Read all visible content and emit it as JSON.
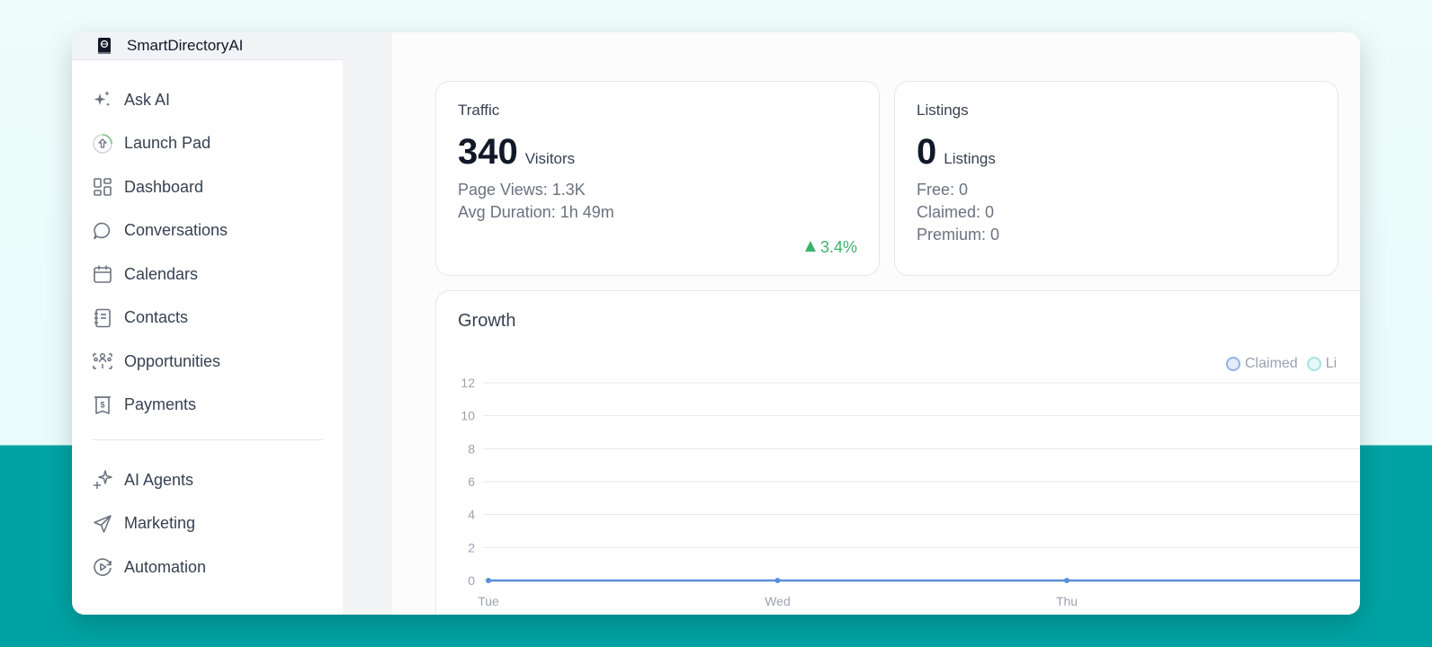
{
  "brand": {
    "name": "SmartDirectoryAI",
    "icon": "book-globe-icon"
  },
  "sidebar": {
    "items": [
      {
        "label": "Ask AI",
        "icon": "sparkles-icon"
      },
      {
        "label": "Launch Pad",
        "icon": "rocket-launch-icon"
      },
      {
        "label": "Dashboard",
        "icon": "dashboard-grid-icon"
      },
      {
        "label": "Conversations",
        "icon": "chat-bubble-icon"
      },
      {
        "label": "Calendars",
        "icon": "calendar-icon"
      },
      {
        "label": "Contacts",
        "icon": "address-book-icon"
      },
      {
        "label": "Opportunities",
        "icon": "opportunities-icon"
      },
      {
        "label": "Payments",
        "icon": "payments-icon"
      }
    ],
    "items2": [
      {
        "label": "AI Agents",
        "icon": "ai-sparkle-icon"
      },
      {
        "label": "Marketing",
        "icon": "send-icon"
      },
      {
        "label": "Automation",
        "icon": "automation-icon"
      }
    ]
  },
  "traffic": {
    "title": "Traffic",
    "value": "340",
    "unit": "Visitors",
    "lines": [
      "Page Views: 1.3K",
      "Avg Duration: 1h 49m"
    ],
    "trend": "3.4%",
    "trend_color": "#3bb36b"
  },
  "listings": {
    "title": "Listings",
    "value": "0",
    "unit": "Listings",
    "lines": [
      "Free: 0",
      "Claimed: 0",
      "Premium: 0"
    ]
  },
  "growth": {
    "title": "Growth",
    "legend": [
      {
        "name": "Claimed",
        "color": "#8fb3e6"
      },
      {
        "name": "Li",
        "color": "#a7e3e0"
      }
    ]
  },
  "chart_data": {
    "type": "line",
    "title": "Growth",
    "x": [
      "Tue",
      "Wed",
      "Thu"
    ],
    "series": [
      {
        "name": "Claimed",
        "values": [
          0,
          0,
          0
        ],
        "color": "#5b8fd9"
      }
    ],
    "yticks": [
      0,
      2,
      4,
      6,
      8,
      10,
      12
    ],
    "ylim": [
      0,
      12
    ],
    "grid": true,
    "legend_position": "top-right"
  }
}
